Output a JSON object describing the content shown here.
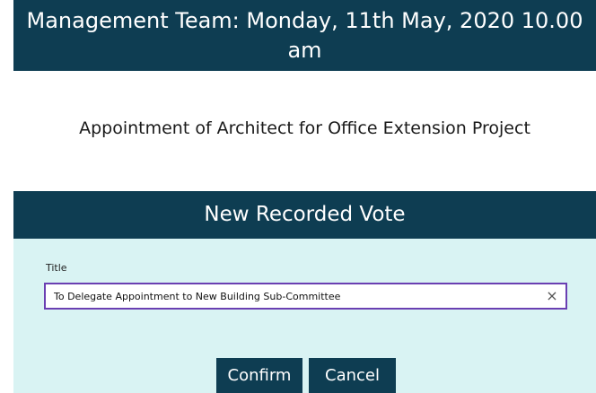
{
  "meeting": {
    "title_line1": "Management Team: Monday, 11th May, 2020 10.00",
    "title_line2": "am"
  },
  "agenda_item": {
    "title": "Appointment of Architect for Office Extension Project"
  },
  "vote_form": {
    "heading": "New Recorded Vote",
    "title_field": {
      "label": "Title",
      "value": "To Delegate Appointment to New Building Sub-Committee",
      "clear_glyph": "×"
    },
    "buttons": {
      "confirm_label": "Confirm",
      "cancel_label": "Cancel"
    }
  },
  "colors": {
    "header_bg": "#0e3d52",
    "panel_bg": "#d9f3f3",
    "input_border": "#6a3fb2"
  }
}
